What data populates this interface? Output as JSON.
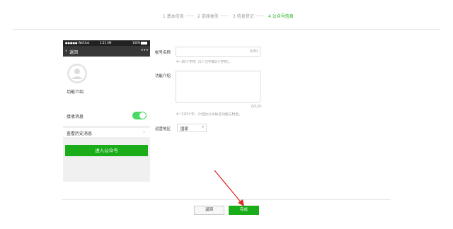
{
  "steps": [
    {
      "label": "1 基本信息"
    },
    {
      "label": "2 选择类型"
    },
    {
      "label": "3 信息登记"
    },
    {
      "label": "4 公众号信息"
    }
  ],
  "phone": {
    "status": {
      "carrier": "●●●●● WeChat",
      "time": "1:21 AM",
      "battery": "100%"
    },
    "nav": {
      "back": "返回",
      "more": "•••"
    },
    "intro_label": "功能介绍",
    "receive_label": "接收消息",
    "history_label": "查看历史消息",
    "enter_button": "进入公众号"
  },
  "form": {
    "name": {
      "label": "帐号名称",
      "value": "",
      "counter": "0/30",
      "hint": "4~30个字符（1个汉字算2个字符）。"
    },
    "intro": {
      "label": "功能介绍",
      "value": "",
      "counter": "0/120",
      "hint": "4~120个字，介绍此公众帐号功能与特色。"
    },
    "region": {
      "label": "运营地区",
      "selected": "国家"
    }
  },
  "footer": {
    "back_button": "返回",
    "done_button": "完成"
  },
  "colors": {
    "accent": "#1aad19",
    "annotation_arrow": "#e02b2b"
  }
}
